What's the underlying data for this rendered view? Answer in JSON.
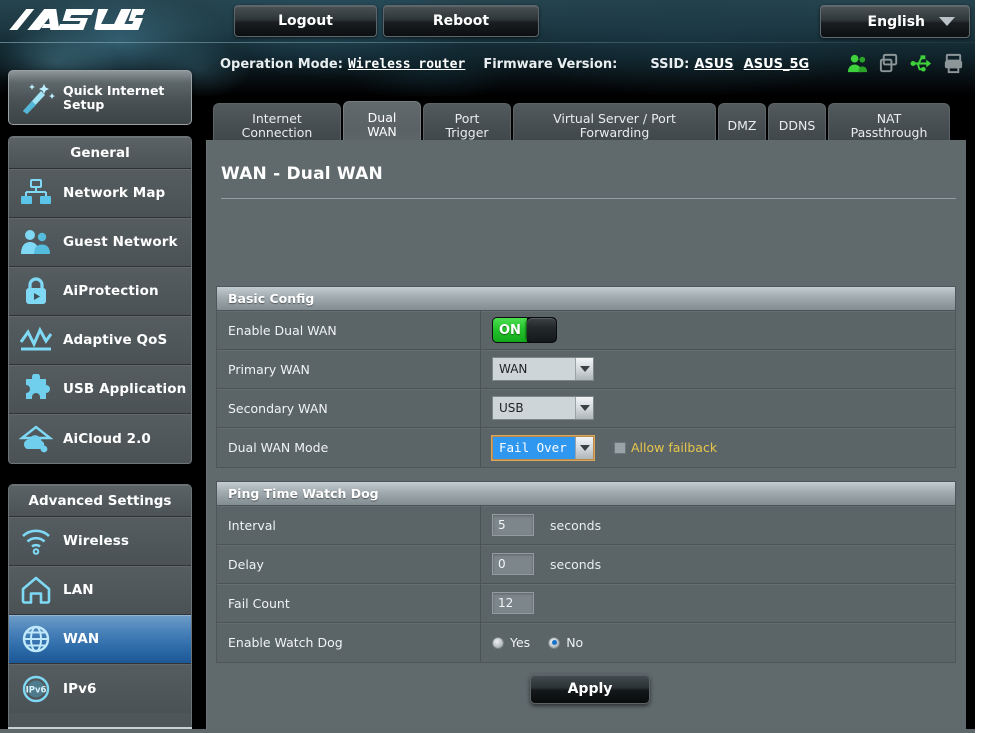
{
  "header": {
    "logo": "/ISUS",
    "logout_label": "Logout",
    "reboot_label": "Reboot",
    "language": "English",
    "operation_mode_key": "Operation Mode:",
    "operation_mode_value": "Wireless router",
    "firmware_key": "Firmware Version:",
    "firmware_value": "",
    "ssid_key": "SSID:",
    "ssid_1": "ASUS",
    "ssid_2": "ASUS_5G",
    "status_icons": [
      {
        "name": "clients-icon",
        "color": "#3ed13b"
      },
      {
        "name": "devices-icon",
        "color": "#8d9699"
      },
      {
        "name": "usb-icon",
        "color": "#3ed13b"
      },
      {
        "name": "printer-icon",
        "color": "#8d9699"
      }
    ]
  },
  "sidebar": {
    "quick_setup": {
      "label_line1": "Quick Internet",
      "label_line2": "Setup",
      "icon": "magic-wand-icon"
    },
    "general": {
      "title": "General",
      "items": [
        {
          "label": "Network Map",
          "icon": "network-map-icon",
          "active": false
        },
        {
          "label": "Guest Network",
          "icon": "guest-network-icon",
          "active": false
        },
        {
          "label": "AiProtection",
          "icon": "shield-lock-icon",
          "active": false
        },
        {
          "label": "Adaptive QoS",
          "icon": "qos-chart-icon",
          "active": false
        },
        {
          "label": "USB Application",
          "icon": "puzzle-piece-icon",
          "active": false
        },
        {
          "label": "AiCloud 2.0",
          "icon": "cloud-icon",
          "active": false
        }
      ]
    },
    "advanced": {
      "title": "Advanced Settings",
      "items": [
        {
          "label": "Wireless",
          "icon": "wifi-icon",
          "active": false
        },
        {
          "label": "LAN",
          "icon": "house-icon",
          "active": false
        },
        {
          "label": "WAN",
          "icon": "globe-icon",
          "active": true
        },
        {
          "label": "IPv6",
          "icon": "ipv6-globe-icon",
          "active": false
        }
      ]
    }
  },
  "tabs": [
    {
      "label": "Internet Connection",
      "active": false
    },
    {
      "label": "Dual WAN",
      "active": true
    },
    {
      "label": "Port Trigger",
      "active": false
    },
    {
      "label": "Virtual Server / Port Forwarding",
      "active": false
    },
    {
      "label": "DMZ",
      "active": false
    },
    {
      "label": "DDNS",
      "active": false
    },
    {
      "label": "NAT Passthrough",
      "active": false
    }
  ],
  "main": {
    "page_title": "WAN - Dual WAN",
    "basic_config": {
      "section_title": "Basic Config",
      "rows": {
        "enable_dual_wan": {
          "label": "Enable Dual WAN",
          "toggle_state": "ON"
        },
        "primary_wan": {
          "label": "Primary WAN",
          "value": "WAN"
        },
        "secondary_wan": {
          "label": "Secondary WAN",
          "value": "USB"
        },
        "dual_wan_mode": {
          "label": "Dual WAN Mode",
          "value": "Fail Over",
          "checkbox_label": "Allow failback",
          "checkbox_checked": false
        }
      }
    },
    "watch_dog": {
      "section_title": "Ping Time Watch Dog",
      "rows": {
        "interval": {
          "label": "Interval",
          "value": "5",
          "unit": "seconds"
        },
        "delay": {
          "label": "Delay",
          "value": "0",
          "unit": "seconds"
        },
        "fail_count": {
          "label": "Fail Count",
          "value": "12",
          "unit": ""
        },
        "enable_watch_dog": {
          "label": "Enable Watch Dog",
          "yes_label": "Yes",
          "no_label": "No",
          "selected": "No"
        }
      }
    },
    "apply_label": "Apply"
  },
  "colors": {
    "panel_bg": "#606a6d",
    "row_bg": "#5b6467",
    "accent_active": "#2f6dab",
    "toggle_on": "#24c42c",
    "checkbox_label": "#e7c64b",
    "select_focus": "#2f97f0"
  }
}
